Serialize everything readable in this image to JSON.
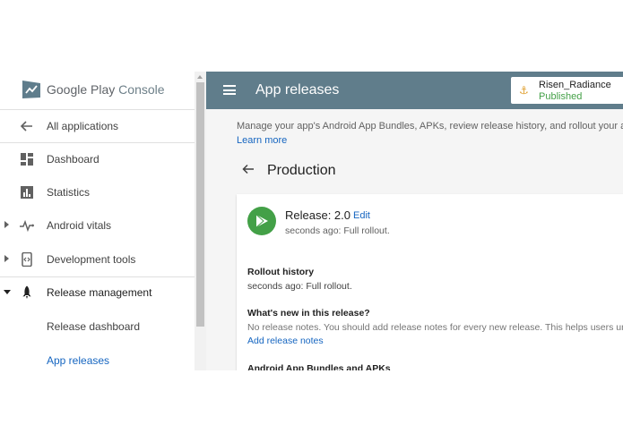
{
  "sidebar": {
    "logo": {
      "brand": "Google Play",
      "product": "Console"
    },
    "items": [
      {
        "label": "All applications",
        "icon": "arrow-left-icon"
      },
      {
        "label": "Dashboard",
        "icon": "dashboard-icon"
      },
      {
        "label": "Statistics",
        "icon": "bar-chart-icon"
      },
      {
        "label": "Android vitals",
        "icon": "pulse-icon"
      },
      {
        "label": "Development tools",
        "icon": "dev-tools-icon"
      },
      {
        "label": "Release management",
        "icon": "rocket-icon"
      },
      {
        "label": "Release dashboard"
      },
      {
        "label": "App releases"
      }
    ]
  },
  "header": {
    "title": "App releases",
    "app": {
      "name": "Risen_Radiance",
      "status": "Published",
      "icon": "anchor-icon"
    }
  },
  "main": {
    "intro": "Manage your app's Android App Bundles, APKs, review release history, and rollout your app to proc",
    "learn_more": "Learn more",
    "page_title": "Production",
    "release": {
      "title": "Release: 2.0",
      "edit": "Edit",
      "time": "seconds ago: Full rollout."
    },
    "rollout": {
      "heading": "Rollout history",
      "text": "seconds ago: Full rollout."
    },
    "whats_new": {
      "heading": "What's new in this release?",
      "text": "No release notes. You should add release notes for every new release. This helps users underst",
      "link": "Add release notes"
    },
    "bundles_heading": "Android App Bundles and APKs"
  },
  "colors": {
    "header": "#607d8b",
    "accent": "#1565c0",
    "play_green": "#43a047"
  }
}
